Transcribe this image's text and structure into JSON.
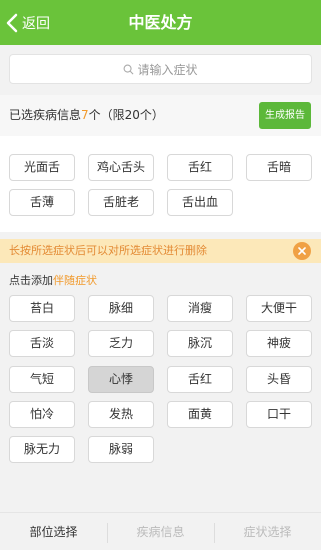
{
  "header": {
    "back_label": "返回",
    "title": "中医处方"
  },
  "search": {
    "placeholder": "请输入症状"
  },
  "selected": {
    "prefix": "已选疾病信息",
    "count": "7",
    "suffix": "个（限20个）",
    "report_button": "生成报告",
    "tags": [
      "光面舌",
      "鸡心舌头",
      "舌红",
      "舌暗",
      "舌薄",
      "舌脏老",
      "舌出血"
    ]
  },
  "notice": {
    "text": "长按所选症状后可以对所选症状进行删除"
  },
  "add_section": {
    "label_prefix": "点击添加",
    "label_accent": "伴随症状",
    "tags": [
      "苔白",
      "脉细",
      "消瘦",
      "大便干",
      "舌淡",
      "乏力",
      "脉沉",
      "神疲",
      "气短",
      "心悸",
      "舌红",
      "头昏",
      "怕冷",
      "发热",
      "面黄",
      "口干",
      "脉无力",
      "脉弱"
    ],
    "active_tag": "心悸"
  },
  "tabs": [
    {
      "label": "部位选择",
      "state": "active"
    },
    {
      "label": "疾病信息",
      "state": "inactive"
    },
    {
      "label": "症状选择",
      "state": "inactive"
    }
  ],
  "colors": {
    "header": "#6ac33a",
    "accent": "#f19a2c",
    "notice_bg": "#fce8b9"
  },
  "icons": {
    "back": "chevron-left-icon",
    "search": "search-icon",
    "close": "close-icon"
  }
}
